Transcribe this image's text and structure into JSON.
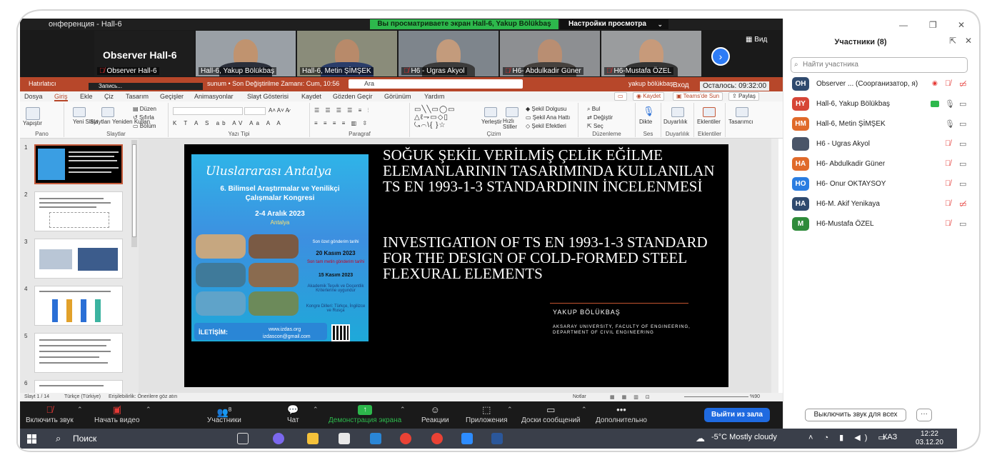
{
  "window": {
    "title": "онференция - Hall-6",
    "share_banner": "Вы просматриваете экран Hall-6, Yakup Bölükbaş",
    "view_settings": "Настройки просмотра",
    "view_button": "Вид"
  },
  "video_tiles": [
    {
      "name": "Observer  Hall-6",
      "big": "Observer  Hall-6",
      "muted": true
    },
    {
      "name": "Hall-6, Yakup Bölükbaş",
      "muted": false
    },
    {
      "name": "Hall-6, Metin ŞİMŞEK",
      "muted": false
    },
    {
      "name": "H6 - Ugras Akyol",
      "muted": true
    },
    {
      "name": "H6- Abdulkadir Güner",
      "muted": true
    },
    {
      "name": "H6-Mustafa ÖZEL",
      "muted": true
    }
  ],
  "ppt": {
    "autosave": "Hatırlatıcı",
    "record_label": "Запись...",
    "doc_title": "sunum • Son Değiştirilme Zamanı: Cum, 10:56",
    "search_placeholder": "Ara",
    "user": "yakup bölükbaş",
    "signin": "Вход",
    "remaining": "Осталось: 09:32:00",
    "tabs": [
      "Dosya",
      "Giriş",
      "Ekle",
      "Çiz",
      "Tasarım",
      "Geçişler",
      "Animasyonlar",
      "Slayt Gösterisi",
      "Kaydet",
      "Gözden Geçir",
      "Görünüm",
      "Yardım"
    ],
    "tab_buttons": {
      "record": "Kaydet",
      "teams": "Teams'de Sun",
      "share": "Paylaş"
    },
    "ribbon_groups": [
      "Pano",
      "Slaytlar",
      "Yazı Tipi",
      "Paragraf",
      "Çizim",
      "Düzenleme",
      "Ses",
      "Duyarlılık",
      "Eklentiler"
    ],
    "ribbon_buttons": {
      "paste": "Yapıştır",
      "new_slide": "Yeni Slayt",
      "reuse": "Slaytları Yeniden Kullan",
      "layout": "Düzen",
      "reset": "Sıfırla",
      "section": "Bölüm",
      "arrange": "Yerleştir",
      "quick_styles": "Hızlı Stiller",
      "shape_fill": "Şekil Dolgusu",
      "shape_outline": "Şekil Ana Hattı",
      "shape_effects": "Şekil Efektleri",
      "find": "Bul",
      "replace": "Değiştir",
      "select": "Seç",
      "dictate": "Dikte",
      "sensitivity": "Duyarlılık",
      "addins": "Eklentiler",
      "designer": "Tasarımcı"
    },
    "thumb_numbers": [
      "1",
      "2",
      "3",
      "4",
      "5",
      "6"
    ],
    "status": {
      "slide": "Slayt 1 / 14",
      "lang": "Türkçe (Türkiye)",
      "access": "Erişilebilirlik: Önerilere göz atın",
      "notes": "Notlar",
      "zoom": "%90"
    }
  },
  "slide": {
    "title_tr": "SOĞUK ŞEKİL VERİLMİŞ ÇELİK EĞİLME ELEMANLARININ TASARIMINDA KULLANILAN TS EN 1993-1-3 STANDARDININ İNCELENMESİ",
    "title_en": "INVESTIGATION OF TS EN 1993-1-3 STANDARD FOR THE DESIGN OF COLD-FORMED STEEL FLEXURAL ELEMENTS",
    "author": "YAKUP BÖLÜKBAŞ",
    "affiliation": "AKSARAY UNIVERSITY, FACULTY OF ENGINEERING, DEPARTMENT OF CIVIL ENGINEERING",
    "poster": {
      "line1": "Uluslararası Antalya",
      "line2": "6. Bilimsel Araştırmalar ve Yenilikçi Çalışmalar Kongresi",
      "dates": "2-4 Aralık 2023",
      "city": "Antalya",
      "r1": "Son özet gönderim tarihi",
      "r2": "20 Kasım 2023",
      "r3": "Son tam metin gönderim tarihi",
      "r4": "15 Kasım 2023",
      "r5": "Akademik Teşvik ve Doçentlik Kriterlerine uygundur",
      "r6": "Kongre Dilleri: Türkçe, İngilizce ve Rusça",
      "contact": "İLETİŞİM:",
      "web": "www.izdas.org",
      "mail": "izdascon@gmail.com"
    }
  },
  "toolbar": {
    "unmute": "Включить звук",
    "start_video": "Начать видео",
    "participants": "Участники",
    "participants_count": "8",
    "chat": "Чат",
    "share": "Демонстрация экрана",
    "reactions": "Реакции",
    "apps": "Приложения",
    "whiteboard": "Доски сообщений",
    "more": "Дополнительно",
    "leave": "Выйти из зала"
  },
  "participants_panel": {
    "title": "Участники (8)",
    "search_placeholder": "Найти участника",
    "unmute_all": "Выключить звук для всех",
    "list": [
      {
        "initials": "OH",
        "name": "Observer ... (Соорганизатор, я)",
        "color": "#2f4a6e"
      },
      {
        "initials": "HY",
        "name": "Hall-6, Yakup Bölükbaş",
        "color": "#d64637"
      },
      {
        "initials": "HM",
        "name": "Hall-6, Metin ŞİMŞEK",
        "color": "#e06a2a"
      },
      {
        "initials": "",
        "name": "H6 - Ugras Akyol",
        "color": "#4a5568"
      },
      {
        "initials": "HA",
        "name": "H6- Abdulkadir Güner",
        "color": "#e06a2a"
      },
      {
        "initials": "HO",
        "name": "H6- Onur OKTAYSOY",
        "color": "#2a7de1"
      },
      {
        "initials": "HA",
        "name": "H6-M. Akif Yenikaya",
        "color": "#2f4a6e"
      },
      {
        "initials": "M",
        "name": "H6-Mustafa ÖZEL",
        "color": "#2e8b3a"
      }
    ]
  },
  "taskbar": {
    "search": "Поиск",
    "weather": "-5°C  Mostly cloudy",
    "lang": "КАЗ",
    "time": "12:22",
    "date": "03.12.20"
  }
}
